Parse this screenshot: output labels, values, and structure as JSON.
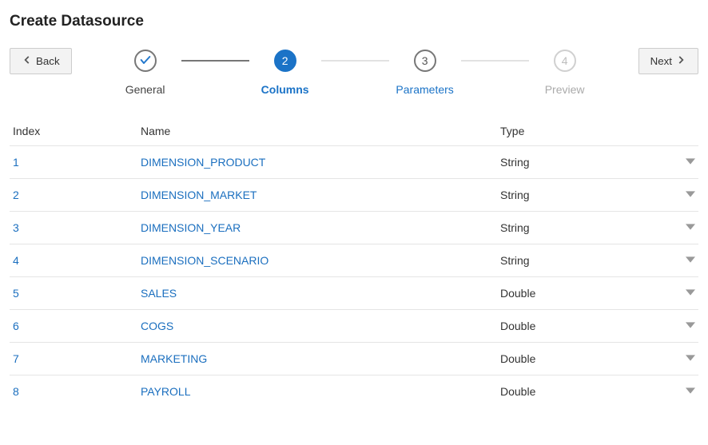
{
  "page_title": "Create Datasource",
  "buttons": {
    "back": "Back",
    "next": "Next"
  },
  "stepper": {
    "steps": [
      {
        "label": "General",
        "state": "done"
      },
      {
        "label": "Columns",
        "state": "active",
        "num": "2"
      },
      {
        "label": "Parameters",
        "state": "future",
        "num": "3"
      },
      {
        "label": "Preview",
        "state": "disabled",
        "num": "4"
      }
    ]
  },
  "table": {
    "headers": {
      "index": "Index",
      "name": "Name",
      "type": "Type"
    },
    "rows": [
      {
        "index": "1",
        "name": "DIMENSION_PRODUCT",
        "type": "String"
      },
      {
        "index": "2",
        "name": "DIMENSION_MARKET",
        "type": "String"
      },
      {
        "index": "3",
        "name": "DIMENSION_YEAR",
        "type": "String"
      },
      {
        "index": "4",
        "name": "DIMENSION_SCENARIO",
        "type": "String"
      },
      {
        "index": "5",
        "name": "SALES",
        "type": "Double"
      },
      {
        "index": "6",
        "name": "COGS",
        "type": "Double"
      },
      {
        "index": "7",
        "name": "MARKETING",
        "type": "Double"
      },
      {
        "index": "8",
        "name": "PAYROLL",
        "type": "Double"
      }
    ]
  }
}
